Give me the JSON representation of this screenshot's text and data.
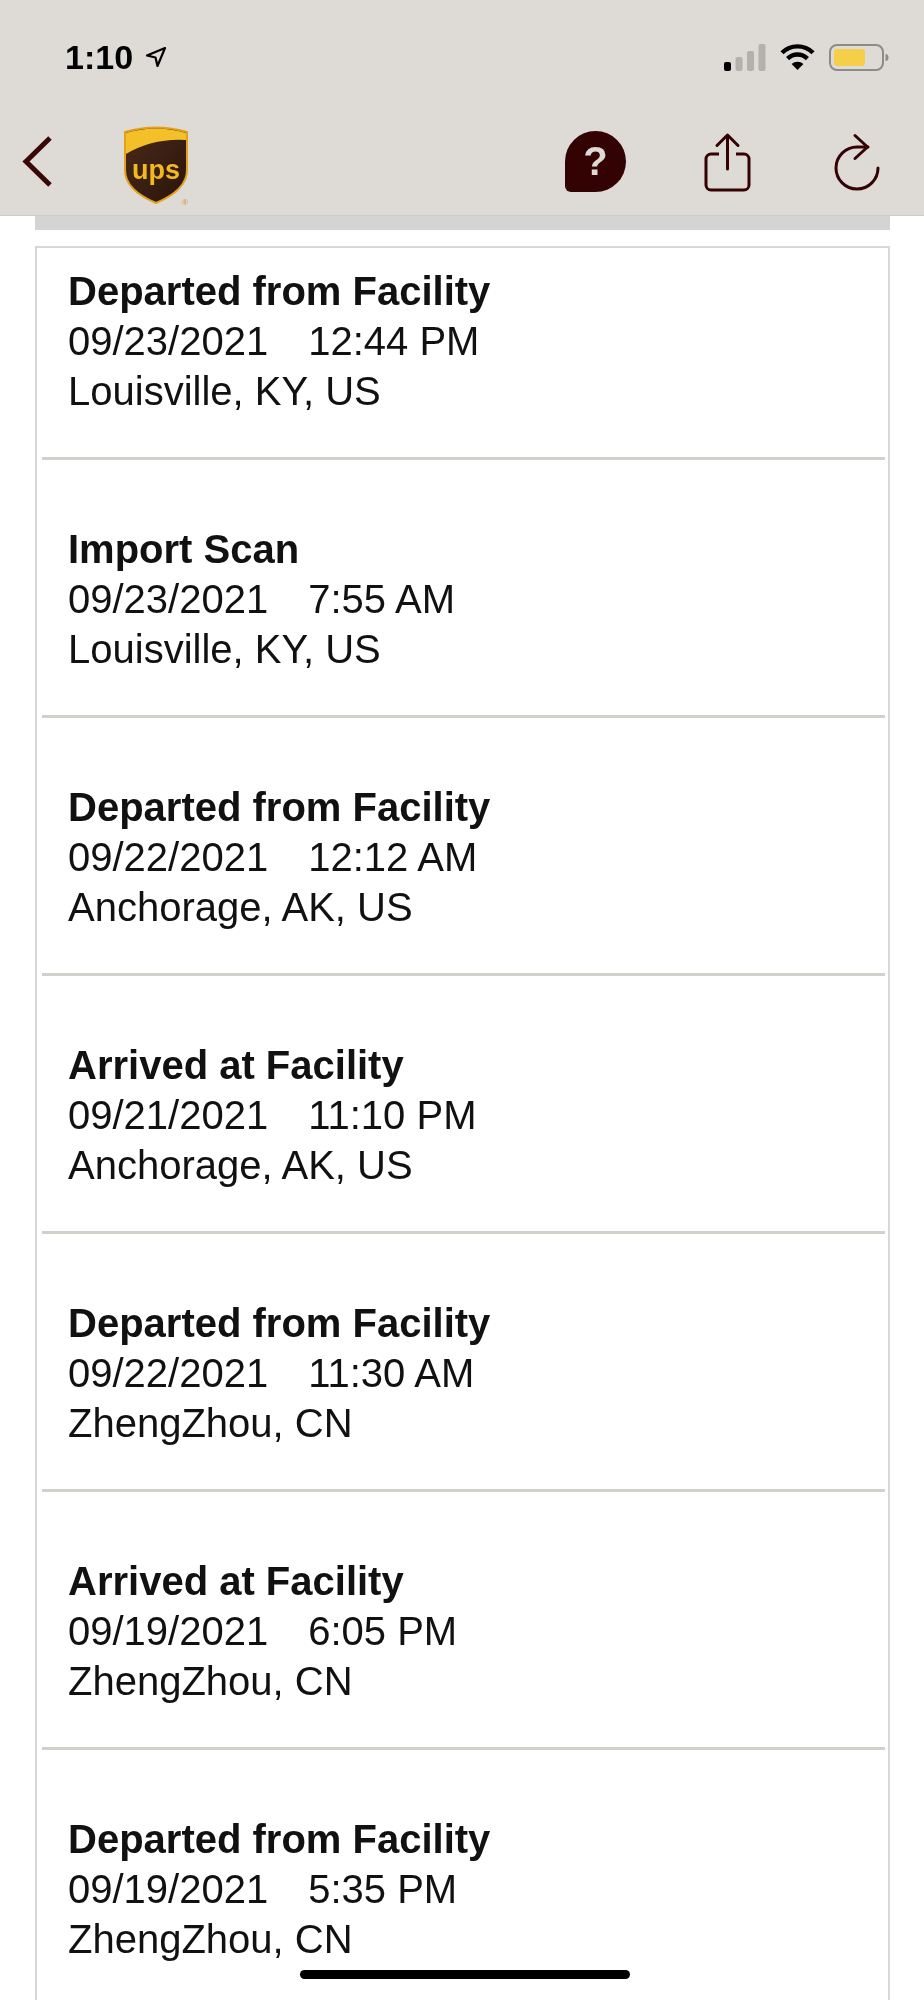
{
  "status_bar": {
    "time": "1:10"
  },
  "nav_bar": {
    "logo_text": "ups",
    "logo_mark": "®",
    "help_label": "?"
  },
  "events": [
    {
      "title": "Departed from Facility",
      "date": "09/23/2021",
      "time": "12:44 PM",
      "location": "Louisville, KY, US"
    },
    {
      "title": "Import Scan",
      "date": "09/23/2021",
      "time": "7:55 AM",
      "location": "Louisville, KY, US"
    },
    {
      "title": "Departed from Facility",
      "date": "09/22/2021",
      "time": "12:12 AM",
      "location": "Anchorage, AK, US"
    },
    {
      "title": "Arrived at Facility",
      "date": "09/21/2021",
      "time": "11:10 PM",
      "location": "Anchorage, AK, US"
    },
    {
      "title": "Departed from Facility",
      "date": "09/22/2021",
      "time": "11:30 AM",
      "location": "ZhengZhou, CN"
    },
    {
      "title": "Arrived at Facility",
      "date": "09/19/2021",
      "time": "6:05 PM",
      "location": "ZhengZhou, CN"
    },
    {
      "title": "Departed from Facility",
      "date": "09/19/2021",
      "time": "5:35 PM",
      "location": "ZhengZhou, CN"
    }
  ]
}
